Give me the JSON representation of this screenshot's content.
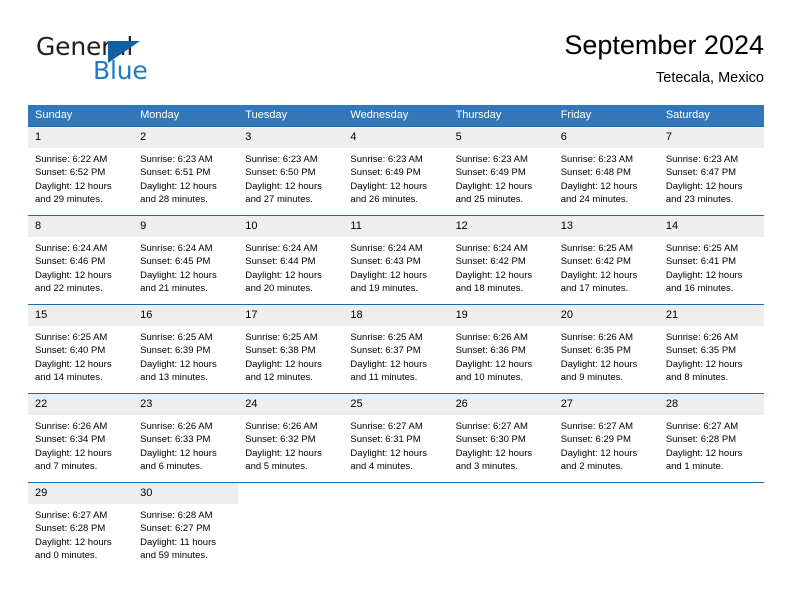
{
  "brand": {
    "name_part1": "General",
    "name_part2": "Blue",
    "logo_icon": "triangle-logo-icon"
  },
  "header": {
    "title": "September 2024",
    "location": "Tetecala, Mexico"
  },
  "theme": {
    "header_bg": "#3377bb",
    "row_divider": "#1a6bb0",
    "daynum_bg": "#eeeeee",
    "brand_blue": "#1e7bc4",
    "logo_blue": "#135fa4"
  },
  "weekday_headers": [
    "Sunday",
    "Monday",
    "Tuesday",
    "Wednesday",
    "Thursday",
    "Friday",
    "Saturday"
  ],
  "labels": {
    "sunrise_prefix": "Sunrise:",
    "sunset_prefix": "Sunset:",
    "daylight_prefix": "Daylight:"
  },
  "weeks": [
    [
      {
        "day": "1",
        "sunrise": "Sunrise: 6:22 AM",
        "sunset": "Sunset: 6:52 PM",
        "daylight_line1": "Daylight: 12 hours",
        "daylight_line2": "and 29 minutes."
      },
      {
        "day": "2",
        "sunrise": "Sunrise: 6:23 AM",
        "sunset": "Sunset: 6:51 PM",
        "daylight_line1": "Daylight: 12 hours",
        "daylight_line2": "and 28 minutes."
      },
      {
        "day": "3",
        "sunrise": "Sunrise: 6:23 AM",
        "sunset": "Sunset: 6:50 PM",
        "daylight_line1": "Daylight: 12 hours",
        "daylight_line2": "and 27 minutes."
      },
      {
        "day": "4",
        "sunrise": "Sunrise: 6:23 AM",
        "sunset": "Sunset: 6:49 PM",
        "daylight_line1": "Daylight: 12 hours",
        "daylight_line2": "and 26 minutes."
      },
      {
        "day": "5",
        "sunrise": "Sunrise: 6:23 AM",
        "sunset": "Sunset: 6:49 PM",
        "daylight_line1": "Daylight: 12 hours",
        "daylight_line2": "and 25 minutes."
      },
      {
        "day": "6",
        "sunrise": "Sunrise: 6:23 AM",
        "sunset": "Sunset: 6:48 PM",
        "daylight_line1": "Daylight: 12 hours",
        "daylight_line2": "and 24 minutes."
      },
      {
        "day": "7",
        "sunrise": "Sunrise: 6:23 AM",
        "sunset": "Sunset: 6:47 PM",
        "daylight_line1": "Daylight: 12 hours",
        "daylight_line2": "and 23 minutes."
      }
    ],
    [
      {
        "day": "8",
        "sunrise": "Sunrise: 6:24 AM",
        "sunset": "Sunset: 6:46 PM",
        "daylight_line1": "Daylight: 12 hours",
        "daylight_line2": "and 22 minutes."
      },
      {
        "day": "9",
        "sunrise": "Sunrise: 6:24 AM",
        "sunset": "Sunset: 6:45 PM",
        "daylight_line1": "Daylight: 12 hours",
        "daylight_line2": "and 21 minutes."
      },
      {
        "day": "10",
        "sunrise": "Sunrise: 6:24 AM",
        "sunset": "Sunset: 6:44 PM",
        "daylight_line1": "Daylight: 12 hours",
        "daylight_line2": "and 20 minutes."
      },
      {
        "day": "11",
        "sunrise": "Sunrise: 6:24 AM",
        "sunset": "Sunset: 6:43 PM",
        "daylight_line1": "Daylight: 12 hours",
        "daylight_line2": "and 19 minutes."
      },
      {
        "day": "12",
        "sunrise": "Sunrise: 6:24 AM",
        "sunset": "Sunset: 6:42 PM",
        "daylight_line1": "Daylight: 12 hours",
        "daylight_line2": "and 18 minutes."
      },
      {
        "day": "13",
        "sunrise": "Sunrise: 6:25 AM",
        "sunset": "Sunset: 6:42 PM",
        "daylight_line1": "Daylight: 12 hours",
        "daylight_line2": "and 17 minutes."
      },
      {
        "day": "14",
        "sunrise": "Sunrise: 6:25 AM",
        "sunset": "Sunset: 6:41 PM",
        "daylight_line1": "Daylight: 12 hours",
        "daylight_line2": "and 16 minutes."
      }
    ],
    [
      {
        "day": "15",
        "sunrise": "Sunrise: 6:25 AM",
        "sunset": "Sunset: 6:40 PM",
        "daylight_line1": "Daylight: 12 hours",
        "daylight_line2": "and 14 minutes."
      },
      {
        "day": "16",
        "sunrise": "Sunrise: 6:25 AM",
        "sunset": "Sunset: 6:39 PM",
        "daylight_line1": "Daylight: 12 hours",
        "daylight_line2": "and 13 minutes."
      },
      {
        "day": "17",
        "sunrise": "Sunrise: 6:25 AM",
        "sunset": "Sunset: 6:38 PM",
        "daylight_line1": "Daylight: 12 hours",
        "daylight_line2": "and 12 minutes."
      },
      {
        "day": "18",
        "sunrise": "Sunrise: 6:25 AM",
        "sunset": "Sunset: 6:37 PM",
        "daylight_line1": "Daylight: 12 hours",
        "daylight_line2": "and 11 minutes."
      },
      {
        "day": "19",
        "sunrise": "Sunrise: 6:26 AM",
        "sunset": "Sunset: 6:36 PM",
        "daylight_line1": "Daylight: 12 hours",
        "daylight_line2": "and 10 minutes."
      },
      {
        "day": "20",
        "sunrise": "Sunrise: 6:26 AM",
        "sunset": "Sunset: 6:35 PM",
        "daylight_line1": "Daylight: 12 hours",
        "daylight_line2": "and 9 minutes."
      },
      {
        "day": "21",
        "sunrise": "Sunrise: 6:26 AM",
        "sunset": "Sunset: 6:35 PM",
        "daylight_line1": "Daylight: 12 hours",
        "daylight_line2": "and 8 minutes."
      }
    ],
    [
      {
        "day": "22",
        "sunrise": "Sunrise: 6:26 AM",
        "sunset": "Sunset: 6:34 PM",
        "daylight_line1": "Daylight: 12 hours",
        "daylight_line2": "and 7 minutes."
      },
      {
        "day": "23",
        "sunrise": "Sunrise: 6:26 AM",
        "sunset": "Sunset: 6:33 PM",
        "daylight_line1": "Daylight: 12 hours",
        "daylight_line2": "and 6 minutes."
      },
      {
        "day": "24",
        "sunrise": "Sunrise: 6:26 AM",
        "sunset": "Sunset: 6:32 PM",
        "daylight_line1": "Daylight: 12 hours",
        "daylight_line2": "and 5 minutes."
      },
      {
        "day": "25",
        "sunrise": "Sunrise: 6:27 AM",
        "sunset": "Sunset: 6:31 PM",
        "daylight_line1": "Daylight: 12 hours",
        "daylight_line2": "and 4 minutes."
      },
      {
        "day": "26",
        "sunrise": "Sunrise: 6:27 AM",
        "sunset": "Sunset: 6:30 PM",
        "daylight_line1": "Daylight: 12 hours",
        "daylight_line2": "and 3 minutes."
      },
      {
        "day": "27",
        "sunrise": "Sunrise: 6:27 AM",
        "sunset": "Sunset: 6:29 PM",
        "daylight_line1": "Daylight: 12 hours",
        "daylight_line2": "and 2 minutes."
      },
      {
        "day": "28",
        "sunrise": "Sunrise: 6:27 AM",
        "sunset": "Sunset: 6:28 PM",
        "daylight_line1": "Daylight: 12 hours",
        "daylight_line2": "and 1 minute."
      }
    ],
    [
      {
        "day": "29",
        "sunrise": "Sunrise: 6:27 AM",
        "sunset": "Sunset: 6:28 PM",
        "daylight_line1": "Daylight: 12 hours",
        "daylight_line2": "and 0 minutes."
      },
      {
        "day": "30",
        "sunrise": "Sunrise: 6:28 AM",
        "sunset": "Sunset: 6:27 PM",
        "daylight_line1": "Daylight: 11 hours",
        "daylight_line2": "and 59 minutes."
      },
      {
        "day": "",
        "sunrise": "",
        "sunset": "",
        "daylight_line1": "",
        "daylight_line2": ""
      },
      {
        "day": "",
        "sunrise": "",
        "sunset": "",
        "daylight_line1": "",
        "daylight_line2": ""
      },
      {
        "day": "",
        "sunrise": "",
        "sunset": "",
        "daylight_line1": "",
        "daylight_line2": ""
      },
      {
        "day": "",
        "sunrise": "",
        "sunset": "",
        "daylight_line1": "",
        "daylight_line2": ""
      },
      {
        "day": "",
        "sunrise": "",
        "sunset": "",
        "daylight_line1": "",
        "daylight_line2": ""
      }
    ]
  ]
}
